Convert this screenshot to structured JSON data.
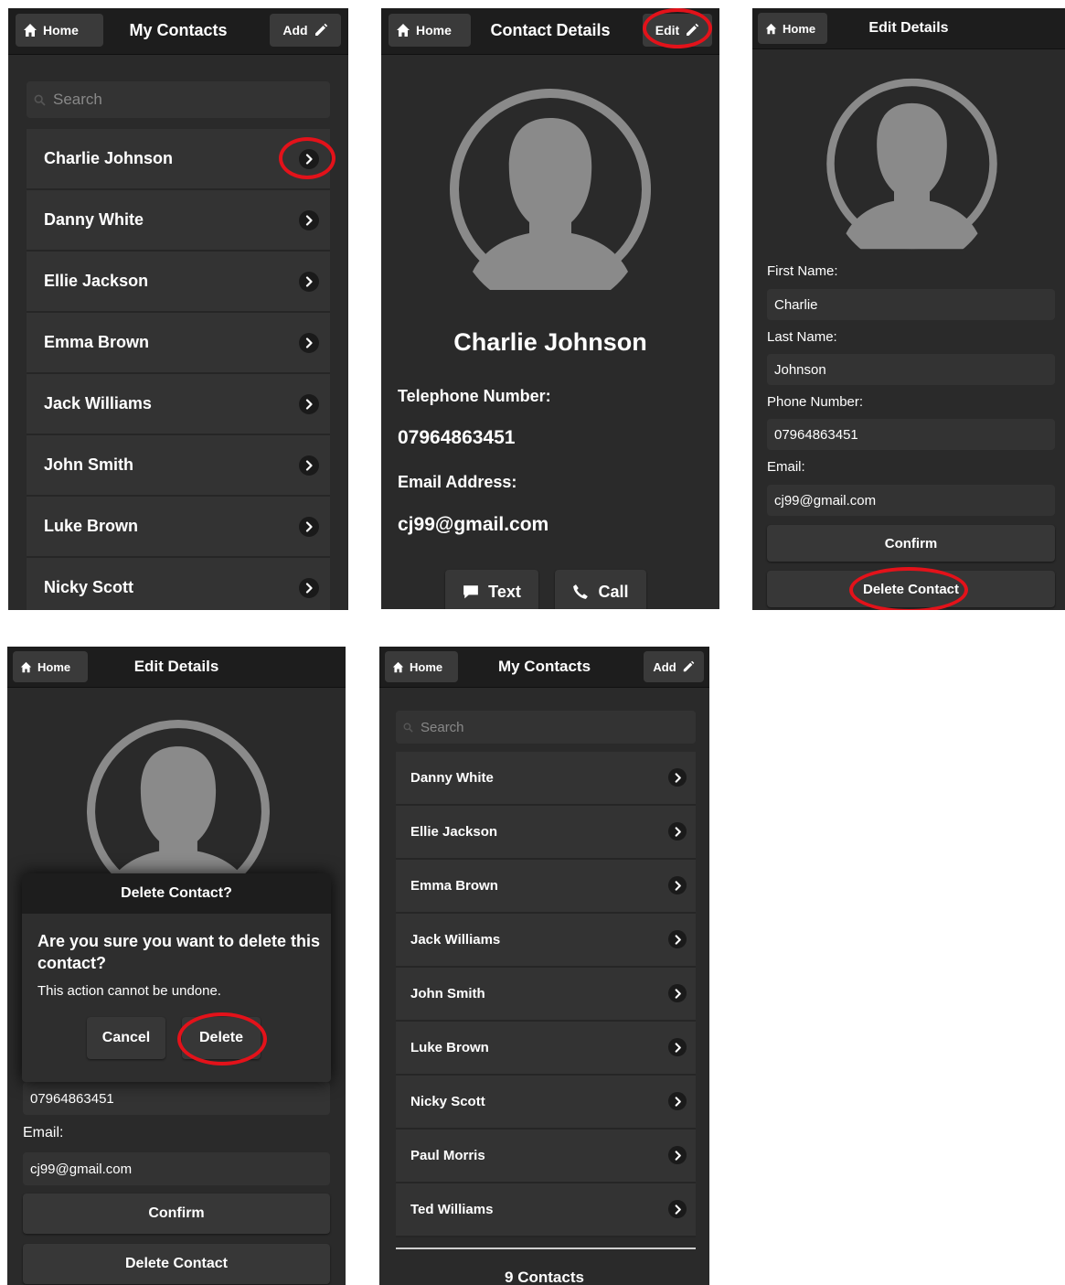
{
  "colors": {
    "background": "#2a2a2a",
    "header": "#1d1d1d",
    "row": "#333333",
    "highlight_ring": "#e3121a",
    "avatar": "#8a8a8a"
  },
  "icons": {
    "home": "home-icon",
    "edit": "pencil-icon",
    "chevron": "chevron-right-icon",
    "search": "search-icon",
    "text": "chat-bubble-icon",
    "call": "phone-icon",
    "avatar": "user-silhouette-icon"
  },
  "s1": {
    "home": "Home",
    "title": "My Contacts",
    "add": "Add",
    "search_placeholder": "Search",
    "contacts": [
      "Charlie Johnson",
      "Danny White",
      "Ellie Jackson",
      "Emma Brown",
      "Jack Williams",
      "John Smith",
      "Luke Brown",
      "Nicky Scott"
    ]
  },
  "s2": {
    "home": "Home",
    "title": "Contact Details",
    "edit": "Edit",
    "name": "Charlie Johnson",
    "tel_label": "Telephone Number:",
    "tel": "07964863451",
    "email_label": "Email Address:",
    "email": "cj99@gmail.com",
    "text_btn": "Text",
    "call_btn": "Call"
  },
  "s3": {
    "home": "Home",
    "title": "Edit Details",
    "first_label": "First Name:",
    "first": "Charlie",
    "last_label": "Last Name:",
    "last": "Johnson",
    "phone_label": "Phone Number:",
    "phone": "07964863451",
    "email_label": "Email:",
    "email": "cj99@gmail.com",
    "confirm": "Confirm",
    "delete": "Delete Contact"
  },
  "s4": {
    "home": "Home",
    "title": "Edit Details",
    "dialog_title": "Delete Contact?",
    "dialog_q": "Are you sure you want to delete this contact?",
    "dialog_note": "This action cannot be undone.",
    "cancel": "Cancel",
    "delete_btn": "Delete",
    "phone": "07964863451",
    "email_label": "Email:",
    "email": "cj99@gmail.com",
    "confirm": "Confirm",
    "delete": "Delete Contact"
  },
  "s5": {
    "home": "Home",
    "title": "My Contacts",
    "add": "Add",
    "search_placeholder": "Search",
    "contacts": [
      "Danny White",
      "Ellie Jackson",
      "Emma Brown",
      "Jack Williams",
      "John Smith",
      "Luke Brown",
      "Nicky Scott",
      "Paul Morris",
      "Ted Williams"
    ],
    "count": "9 Contacts"
  }
}
